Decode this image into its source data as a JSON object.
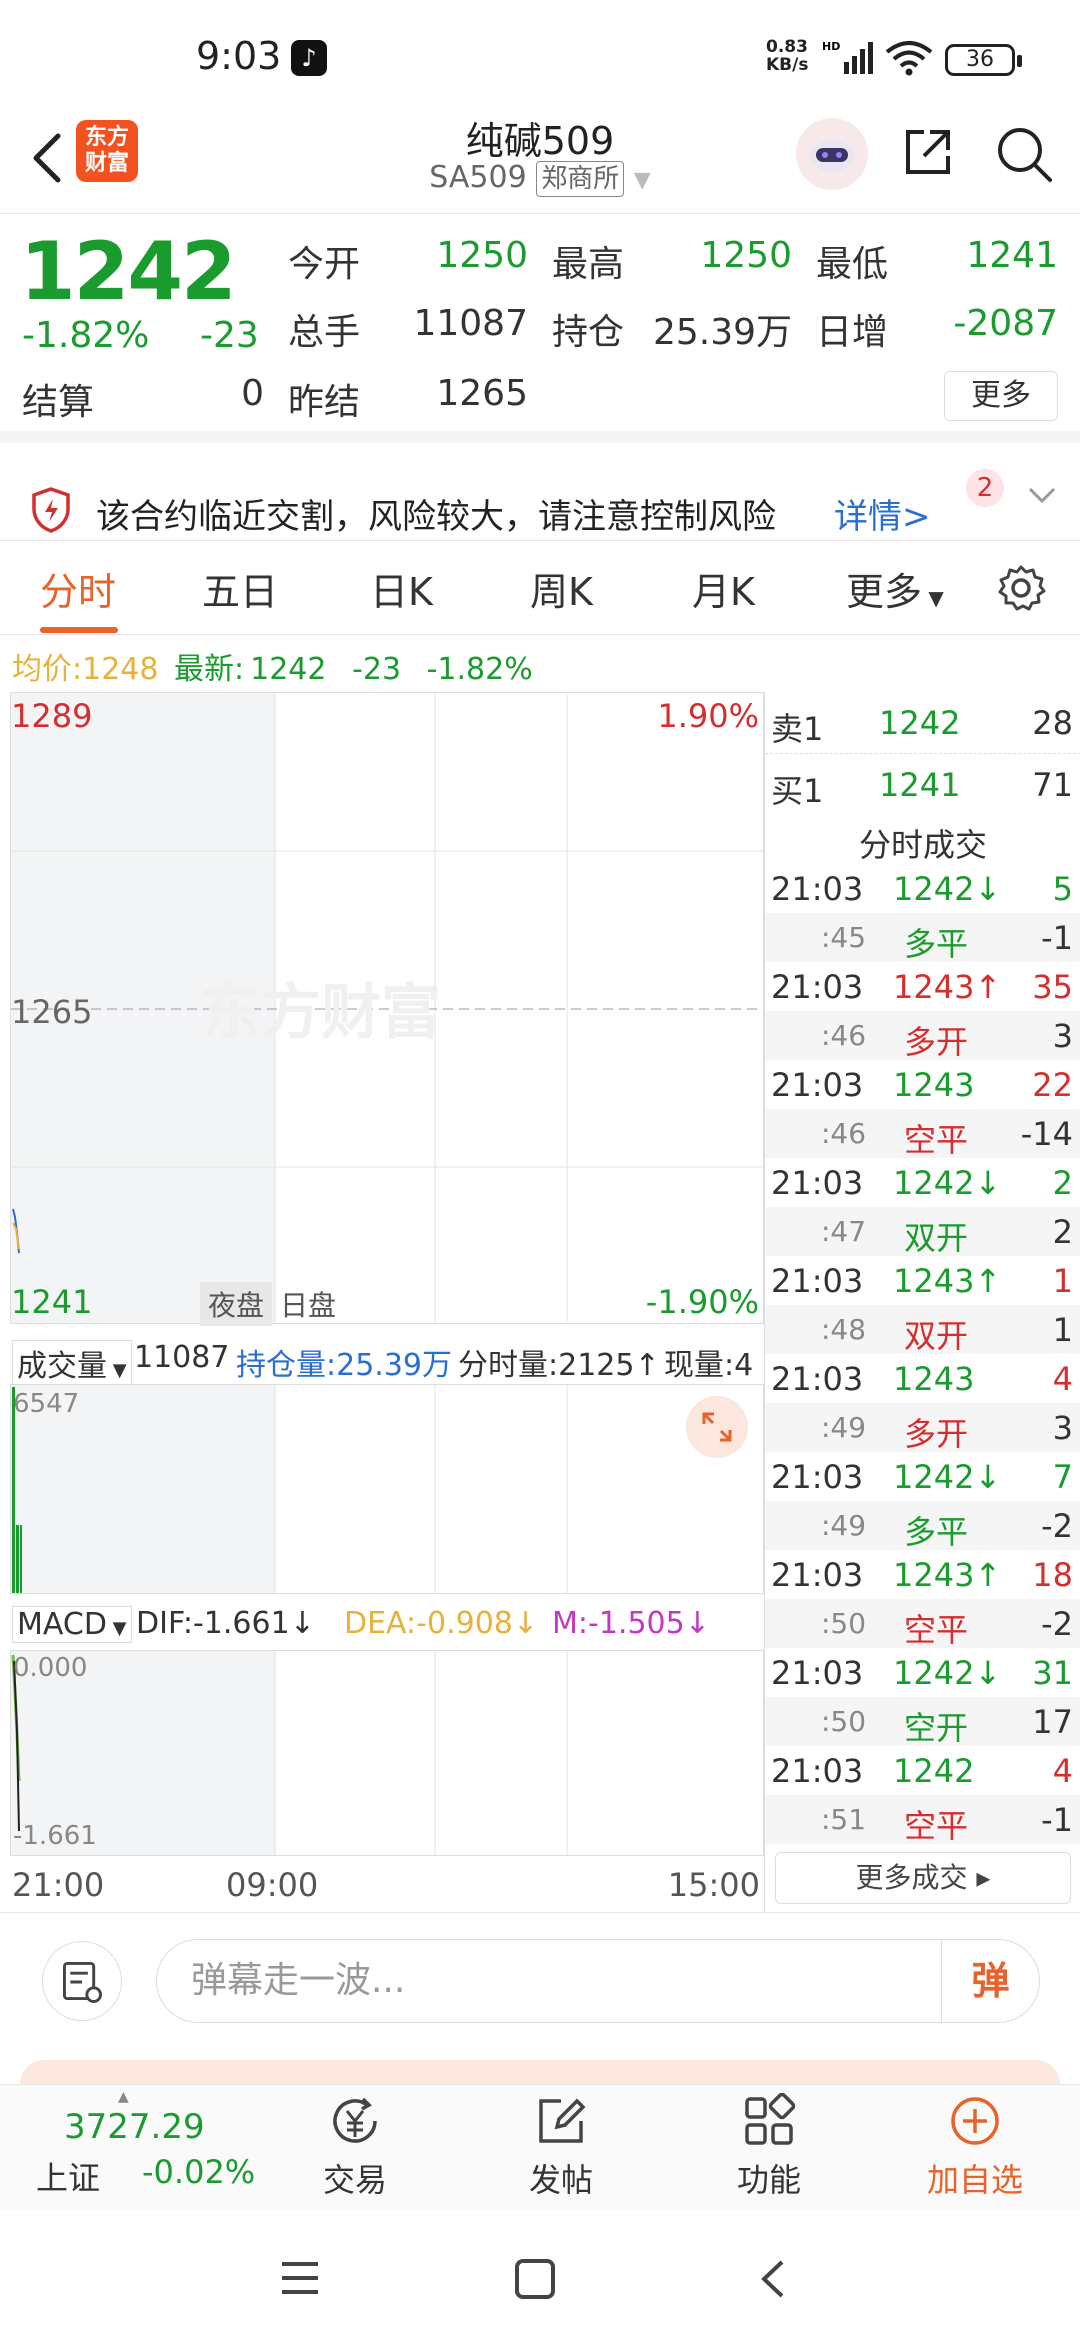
{
  "status": {
    "time": "9:03",
    "speed_top": "0.83",
    "speed_bottom": "KB/s",
    "network": "HD",
    "battery": "36"
  },
  "header": {
    "logo_line1": "东方",
    "logo_line2": "财富",
    "title": "纯碱509",
    "code": "SA509",
    "exchange": "郑商所"
  },
  "quote": {
    "price": "1242",
    "pct": "-1.82%",
    "chg": "-23",
    "open_label": "今开",
    "open": "1250",
    "high_label": "最高",
    "high": "1250",
    "low_label": "最低",
    "low": "1241",
    "vol_label": "总手",
    "vol": "11087",
    "oi_label": "持仓",
    "oi": "25.39万",
    "daily_label": "日增",
    "daily": "-2087",
    "settle_label": "结算",
    "settle": "0",
    "prev_label": "昨结",
    "prev": "1265",
    "more": "更多"
  },
  "notice": {
    "text": "该合约临近交割，风险较大，请注意控制风险",
    "link": "详情>",
    "badge": "2"
  },
  "tabs": [
    "分时",
    "五日",
    "日K",
    "周K",
    "月K",
    "更多"
  ],
  "avgline": {
    "avg_label": "均价:",
    "avg": "1248",
    "last_label": "最新:",
    "last": "1242",
    "chg": "-23",
    "pct": "-1.82%"
  },
  "chart": {
    "ymax": "1289",
    "ymid": "1265",
    "ymin": "1241",
    "pct_top": "1.90%",
    "pct_bottom": "-1.90%",
    "night": "夜盘",
    "day": "日盘",
    "watermark": "东方财富"
  },
  "volume": {
    "label": "成交量",
    "total": "11087",
    "oi": "持仓量:25.39万",
    "fen": "分时量:2125↑",
    "now": "现量:4",
    "max": "6547"
  },
  "macd": {
    "label": "MACD",
    "dif": "DIF:-1.661↓",
    "dea": "DEA:-0.908↓",
    "m": "M:-1.505↓",
    "top": "0.000",
    "bottom": "-1.661"
  },
  "time_axis": [
    "21:00",
    "09:00",
    "15:00"
  ],
  "orderbook": [
    {
      "label": "卖1",
      "price": "1242",
      "vol": "28"
    },
    {
      "label": "买1",
      "price": "1241",
      "vol": "71"
    }
  ],
  "trades_title": "分时成交",
  "trades": [
    {
      "time": "21:03",
      "price": "1242↓",
      "pc": "green",
      "n": "5",
      "nc": "green",
      "sec": ":45",
      "kind": "多平",
      "kc": "green",
      "n2": "-1"
    },
    {
      "time": "21:03",
      "price": "1243↑",
      "pc": "red",
      "n": "35",
      "nc": "red",
      "sec": ":46",
      "kind": "多开",
      "kc": "red",
      "n2": "3"
    },
    {
      "time": "21:03",
      "price": "1243",
      "pc": "green",
      "n": "22",
      "nc": "red",
      "sec": ":46",
      "kind": "空平",
      "kc": "red",
      "n2": "-14"
    },
    {
      "time": "21:03",
      "price": "1242↓",
      "pc": "green",
      "n": "2",
      "nc": "green",
      "sec": ":47",
      "kind": "双开",
      "kc": "green",
      "n2": "2"
    },
    {
      "time": "21:03",
      "price": "1243↑",
      "pc": "green",
      "n": "1",
      "nc": "red",
      "sec": ":48",
      "kind": "双开",
      "kc": "red",
      "n2": "1"
    },
    {
      "time": "21:03",
      "price": "1243",
      "pc": "green",
      "n": "4",
      "nc": "red",
      "sec": ":49",
      "kind": "多开",
      "kc": "red",
      "n2": "3"
    },
    {
      "time": "21:03",
      "price": "1242↓",
      "pc": "green",
      "n": "7",
      "nc": "green",
      "sec": ":49",
      "kind": "多平",
      "kc": "green",
      "n2": "-2"
    },
    {
      "time": "21:03",
      "price": "1243↑",
      "pc": "green",
      "n": "18",
      "nc": "red",
      "sec": ":50",
      "kind": "空平",
      "kc": "red",
      "n2": "-2"
    },
    {
      "time": "21:03",
      "price": "1242↓",
      "pc": "green",
      "n": "31",
      "nc": "green",
      "sec": ":50",
      "kind": "空开",
      "kc": "green",
      "n2": "17"
    },
    {
      "time": "21:03",
      "price": "1242",
      "pc": "green",
      "n": "4",
      "nc": "red",
      "sec": ":51",
      "kind": "空平",
      "kc": "red",
      "n2": "-1"
    }
  ],
  "more_trades": "更多成交 ▸",
  "comment": {
    "placeholder": "弹幕走一波...",
    "dan": "弹"
  },
  "bottom_nav": {
    "index_value": "3727.29",
    "index_name": "上证",
    "index_chg": "-0.02%",
    "items": [
      "交易",
      "发帖",
      "功能",
      "加自选"
    ]
  },
  "colors": {
    "accent": "#e8622a",
    "up": "#d32f2f",
    "down": "#1a9b2e",
    "link": "#2a6fd0"
  }
}
